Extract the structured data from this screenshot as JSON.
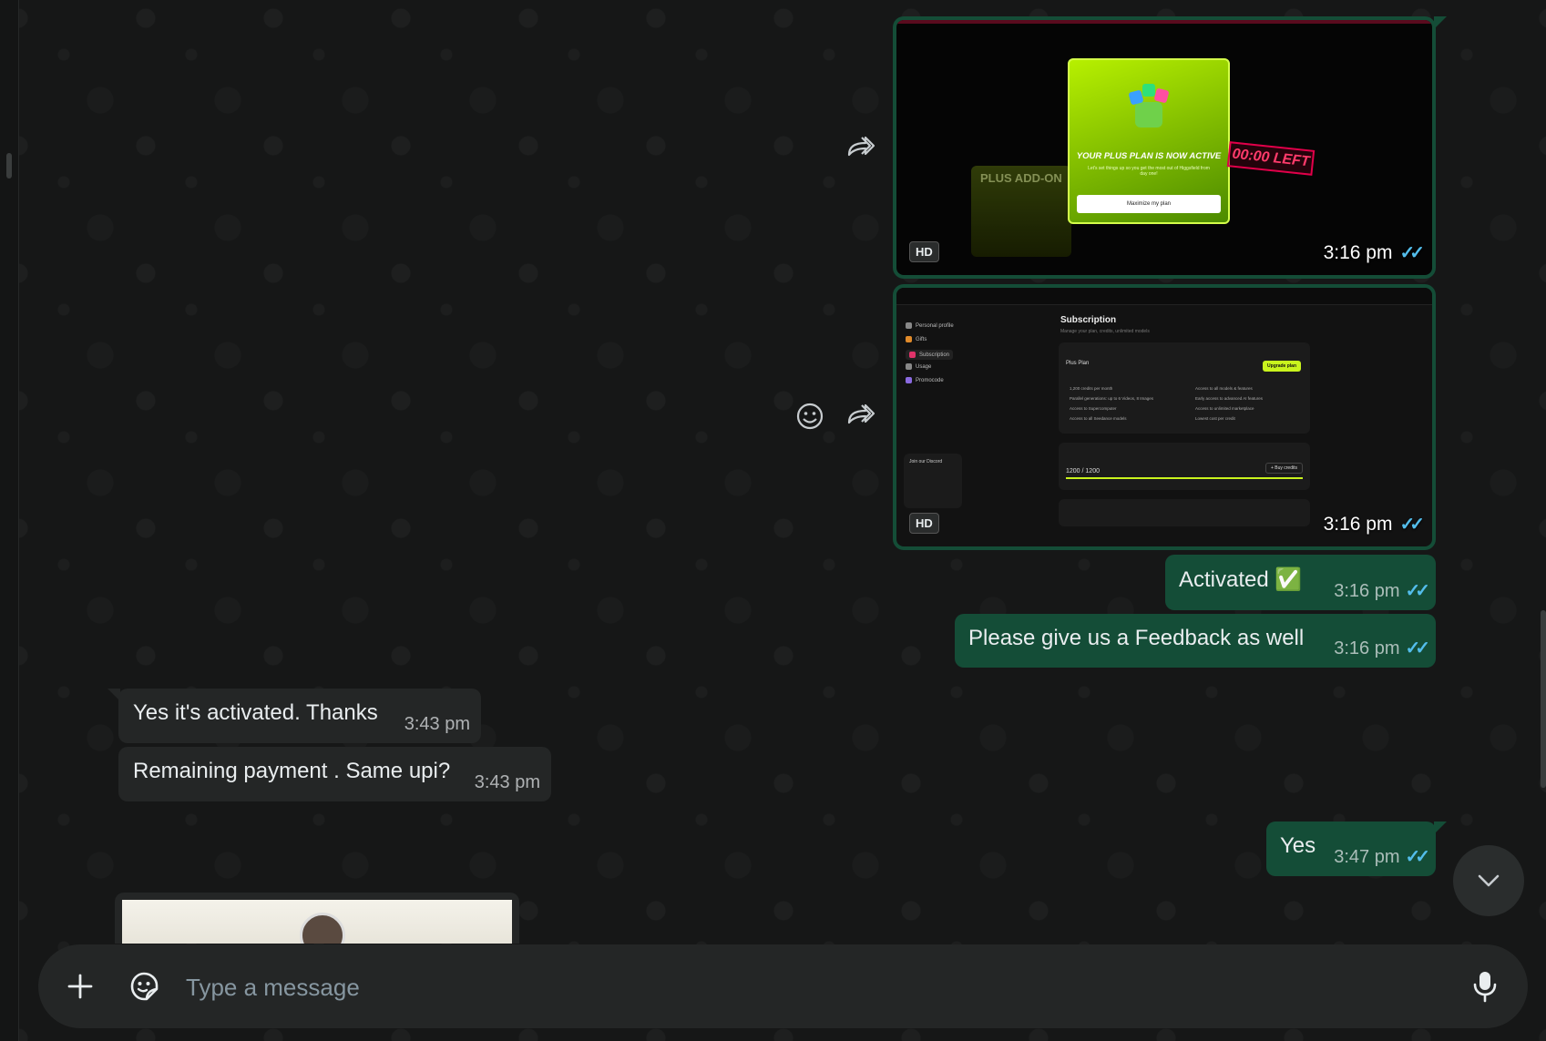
{
  "messages": [
    {
      "dir": "out",
      "type": "image",
      "time": "3:16 pm",
      "badge": "HD",
      "preview": {
        "popup_title": "YOUR PLUS PLAN IS NOW ACTIVE",
        "popup_sub": "Let's set things up so you get the most out of Higgsfield from day one!",
        "popup_button": "Maximize my plan",
        "addon_label": "PLUS ADD-ON",
        "timer": "00:00 LEFT"
      }
    },
    {
      "dir": "out",
      "type": "image",
      "time": "3:16 pm",
      "badge": "HD",
      "preview": {
        "title": "Subscription",
        "subtitle": "Manage your plan, credits, unlimited models",
        "plan": "Plus Plan",
        "upgrade": "Upgrade plan",
        "sidebar": [
          "Personal profile",
          "Gifts",
          "Subscription",
          "Usage",
          "Promocode"
        ],
        "features_left": [
          "1,200 credits per month",
          "Parallel generations: up to 6 Videos, 8 Images",
          "Access to Supercomputer",
          "Access to all Seedance models"
        ],
        "features_right": [
          "Access to all models & features",
          "Early access to advanced AI features",
          "Access to unlimited marketplace",
          "Lowest cost per credit"
        ],
        "credits": "1200 / 1200",
        "buy": "+ Buy credits",
        "discord": "Join our Discord"
      }
    },
    {
      "dir": "out",
      "type": "text",
      "text": "Activated ✅",
      "time": "3:16 pm"
    },
    {
      "dir": "out",
      "type": "text",
      "text": "Please give us a Feedback as well",
      "time": "3:16 pm"
    },
    {
      "dir": "in",
      "type": "text",
      "text": "Yes it's activated. Thanks",
      "time": "3:43 pm"
    },
    {
      "dir": "in",
      "type": "text",
      "text": "Remaining payment . Same upi?",
      "time": "3:43 pm"
    },
    {
      "dir": "out",
      "type": "text",
      "text": "Yes",
      "time": "3:47 pm"
    }
  ],
  "composer": {
    "placeholder": "Type a message"
  },
  "icons": {
    "attach": "plus-icon",
    "sticker": "sticker-icon",
    "mic": "microphone-icon",
    "forward": "forward-icon",
    "react": "emoji-react-icon",
    "scroll": "chevron-down-icon"
  },
  "colors": {
    "outgoing": "#144d37",
    "incoming": "#242626",
    "background": "#161717",
    "read_ticks": "#53bdeb"
  }
}
